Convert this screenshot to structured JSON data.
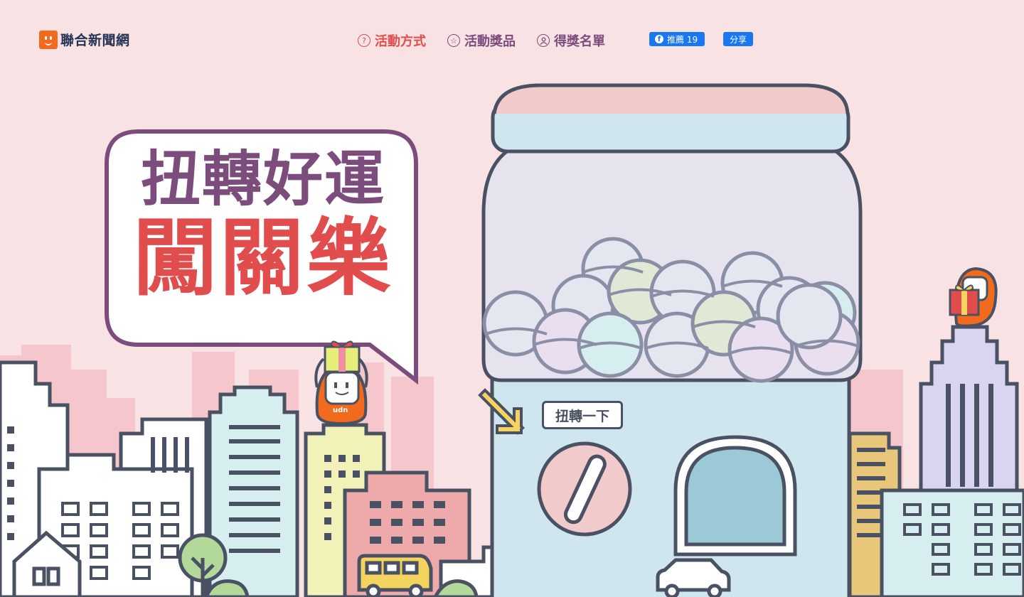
{
  "logo": {
    "text": "聯合新聞網"
  },
  "nav": [
    {
      "label": "活動方式",
      "icon": "question-icon",
      "glyph": "?"
    },
    {
      "label": "活動獎品",
      "icon": "star-icon",
      "glyph": "☆"
    },
    {
      "label": "得獎名單",
      "icon": "user-icon",
      "glyph": "👤"
    }
  ],
  "facebook": {
    "like_label": "推薦 19",
    "share_label": "分享",
    "f_glyph": "f"
  },
  "hero": {
    "title_line1": "扭轉好運",
    "title_line2": "闖關樂"
  },
  "machine": {
    "twist_button": "扭轉一下"
  },
  "mascot": {
    "label": "udn"
  },
  "colors": {
    "background": "#f9e2e4",
    "accent_red": "#e14c4c",
    "accent_purple": "#7c4d7c",
    "machine_body": "#cfe6ef",
    "outline": "#4a5163",
    "brand_orange": "#f26b1d"
  }
}
